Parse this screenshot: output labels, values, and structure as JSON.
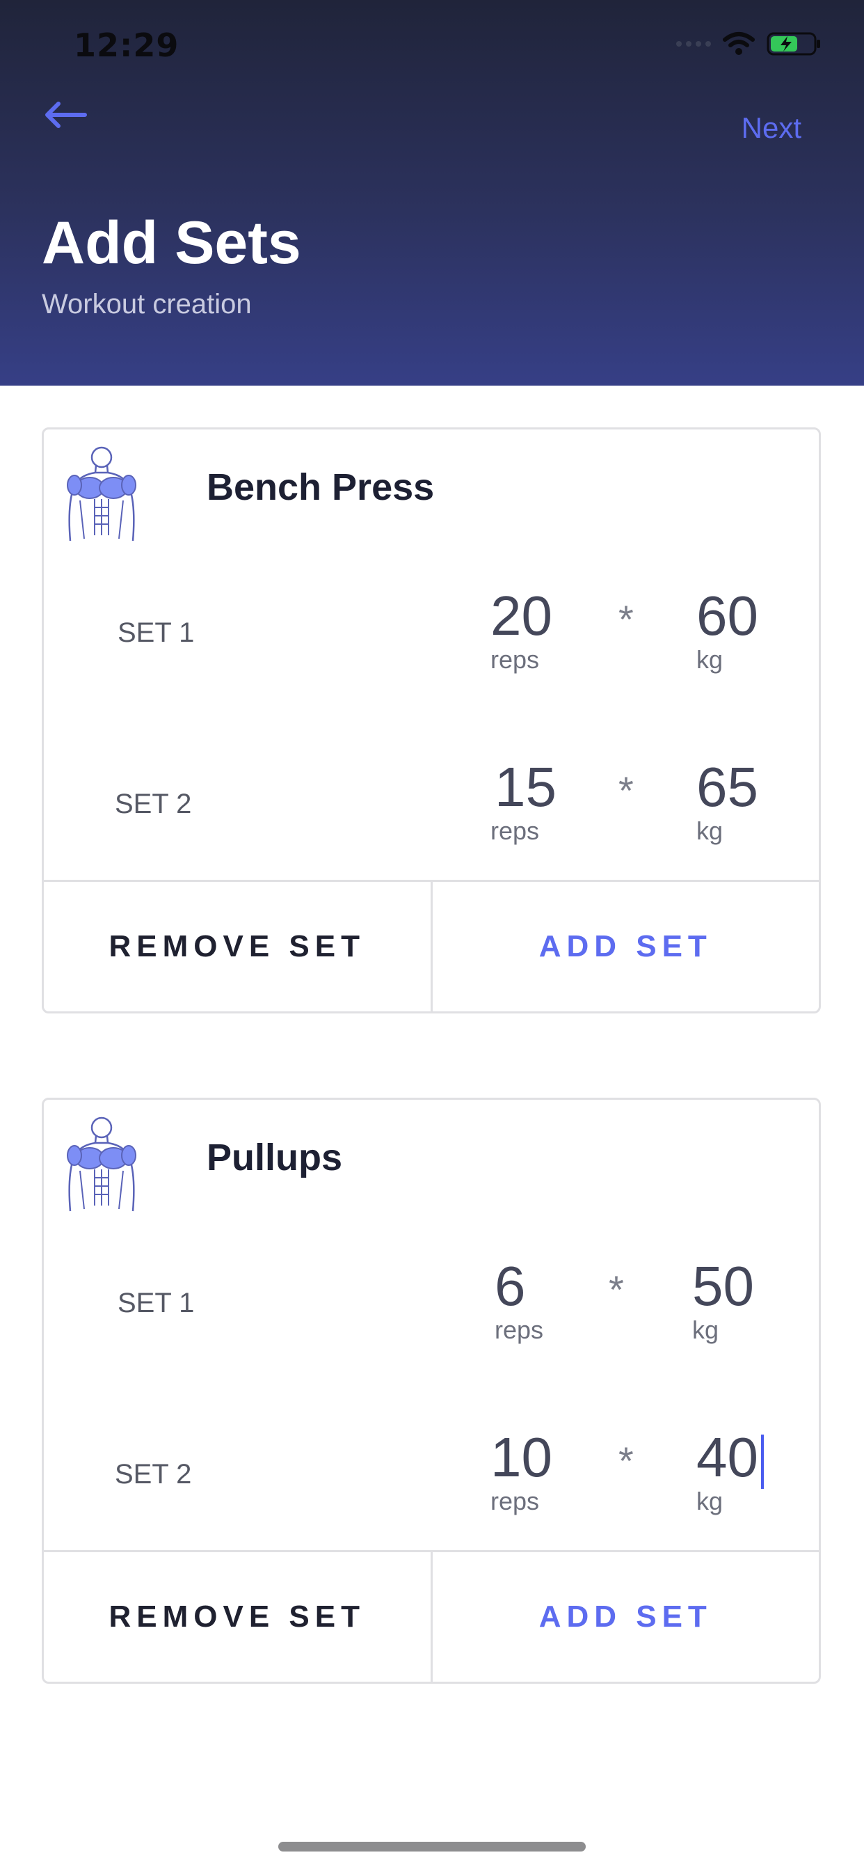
{
  "status_bar": {
    "time": "12:29"
  },
  "header": {
    "next_label": "Next",
    "title": "Add Sets",
    "subtitle": "Workout creation"
  },
  "exercises": [
    {
      "name": "Bench Press",
      "sets": [
        {
          "label": "SET 1",
          "reps": "20",
          "reps_unit": "reps",
          "weight": "60",
          "weight_unit": "kg"
        },
        {
          "label": "SET 2",
          "reps": "15",
          "reps_unit": "reps",
          "weight": "65",
          "weight_unit": "kg"
        }
      ],
      "remove_label": "REMOVE SET",
      "add_label": "ADD SET"
    },
    {
      "name": "Pullups",
      "sets": [
        {
          "label": "SET 1",
          "reps": "6",
          "reps_unit": "reps",
          "weight": "50",
          "weight_unit": "kg"
        },
        {
          "label": "SET 2",
          "reps": "10",
          "reps_unit": "reps",
          "weight": "40",
          "weight_unit": "kg"
        }
      ],
      "remove_label": "REMOVE SET",
      "add_label": "ADD SET"
    }
  ],
  "multiply_symbol": "*",
  "colors": {
    "accent": "#5d6cf0",
    "header_dark": "#20243a",
    "header_light": "#363f86"
  },
  "icons": {
    "back": "arrow-left-icon",
    "exercise": "muscle-body-icon"
  }
}
